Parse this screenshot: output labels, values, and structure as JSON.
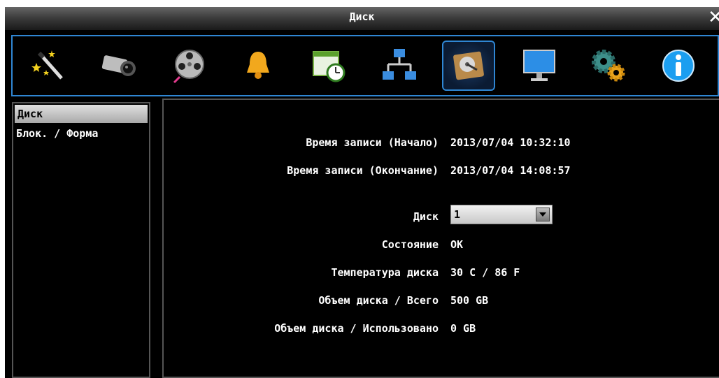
{
  "window": {
    "title": "Диск",
    "close_glyph": "✕"
  },
  "toolbar": {
    "items": [
      {
        "name": "wizard-icon",
        "active": false
      },
      {
        "name": "camera-icon",
        "active": false
      },
      {
        "name": "film-reel-icon",
        "active": false
      },
      {
        "name": "bell-icon",
        "active": false
      },
      {
        "name": "schedule-clock-icon",
        "active": false
      },
      {
        "name": "network-icon",
        "active": false
      },
      {
        "name": "hard-disk-icon",
        "active": true
      },
      {
        "name": "monitor-icon",
        "active": false
      },
      {
        "name": "gears-icon",
        "active": false
      },
      {
        "name": "info-icon",
        "active": false
      }
    ],
    "accent": "#2f86d3"
  },
  "sidebar": {
    "items": [
      {
        "label": "Диск",
        "selected": true
      },
      {
        "label": "Блок. / Форма",
        "selected": false
      }
    ]
  },
  "content": {
    "rows": [
      {
        "label": "Время записи (Начало)",
        "value": "2013/07/04 10:32:10"
      },
      {
        "label": "Время записи (Окончание)",
        "value": "2013/07/04 14:08:57"
      }
    ],
    "disk_select": {
      "label": "Диск",
      "value": "1"
    },
    "info": [
      {
        "label": "Состояние",
        "value": "OK"
      },
      {
        "label": "Температура диска",
        "value": "30 C / 86 F"
      },
      {
        "label": "Объем диска / Всего",
        "value": "500 GB"
      },
      {
        "label": "Объем диска / Использовано",
        "value": "0 GB"
      }
    ]
  }
}
